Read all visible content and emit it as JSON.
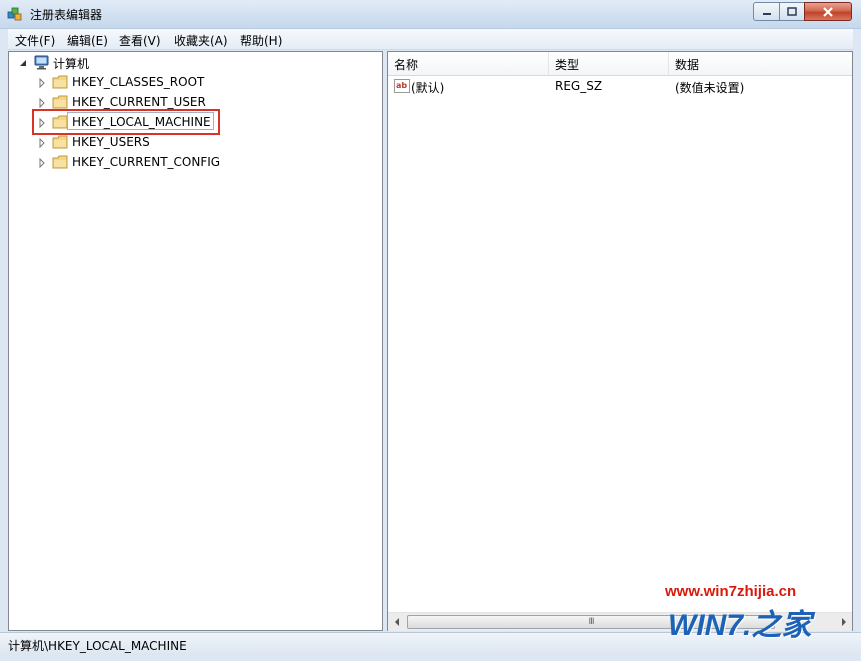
{
  "window": {
    "title": "注册表编辑器",
    "icon": "regedit-icon"
  },
  "window_controls": {
    "minimize": "minimize-icon",
    "maximize": "maximize-icon",
    "close": "close-icon"
  },
  "menu": [
    "文件(F)",
    "编辑(E)",
    "查看(V)",
    "收藏夹(A)",
    "帮助(H)"
  ],
  "tree": {
    "root": {
      "label": "计算机",
      "icon": "computer-icon",
      "expanded": true
    },
    "children": [
      {
        "label": "HKEY_CLASSES_ROOT",
        "icon": "folder-icon"
      },
      {
        "label": "HKEY_CURRENT_USER",
        "icon": "folder-icon"
      },
      {
        "label": "HKEY_LOCAL_MACHINE",
        "icon": "folder-icon",
        "selected": true,
        "highlighted": true
      },
      {
        "label": "HKEY_USERS",
        "icon": "folder-icon"
      },
      {
        "label": "HKEY_CURRENT_CONFIG",
        "icon": "folder-icon"
      }
    ]
  },
  "values_list": {
    "columns": [
      "名称",
      "类型",
      "数据"
    ],
    "rows": [
      {
        "name": "(默认)",
        "type": "REG_SZ",
        "data": "(数值未设置)",
        "icon": "string-value-icon"
      }
    ]
  },
  "scrollbar": {
    "thumb_grip": "III"
  },
  "status": {
    "path": "计算机\\HKEY_LOCAL_MACHINE"
  },
  "watermark": {
    "url": "www.win7zhijia.cn",
    "brand": "WIN7.之家"
  },
  "colors": {
    "highlight_border": "#d9322b",
    "watermark_red": "#d8190b",
    "watermark_blue": "#1c63b7"
  }
}
